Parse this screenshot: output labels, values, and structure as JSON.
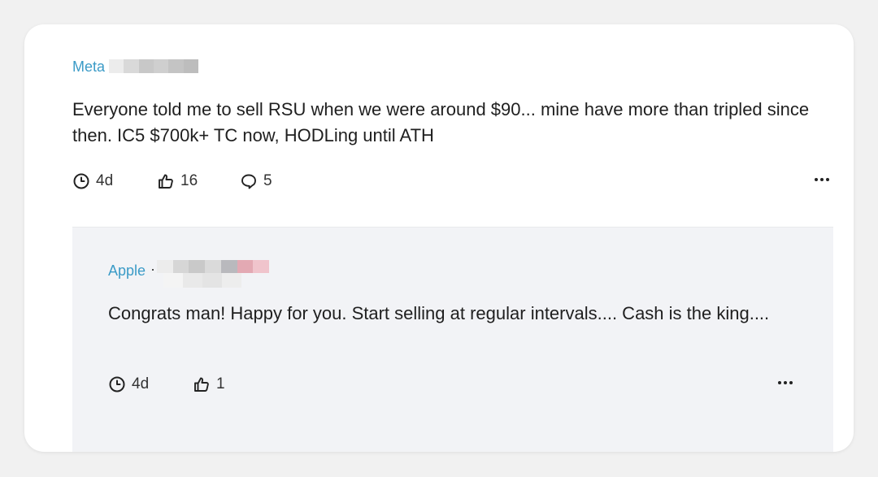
{
  "post": {
    "company": "Meta",
    "text": "Everyone told me to sell RSU when we were around $90... mine have more than tripled since then. IC5 $700k+ TC now, HODLing until ATH",
    "age": "4d",
    "likes": "16",
    "comments": "5"
  },
  "reply": {
    "company": "Apple",
    "separator": "·",
    "text": "Congrats man! Happy for you. Start selling at regular intervals.... Cash is the king....",
    "age": "4d",
    "likes": "1"
  },
  "icons": {
    "clock": "clock-icon",
    "like": "thumbs-up-icon",
    "comment": "comment-icon",
    "more": "more-horizontal-icon"
  },
  "colors": {
    "company_link": "#3b9bc7",
    "reply_background": "#f2f3f6",
    "text": "#1f1f1f"
  }
}
